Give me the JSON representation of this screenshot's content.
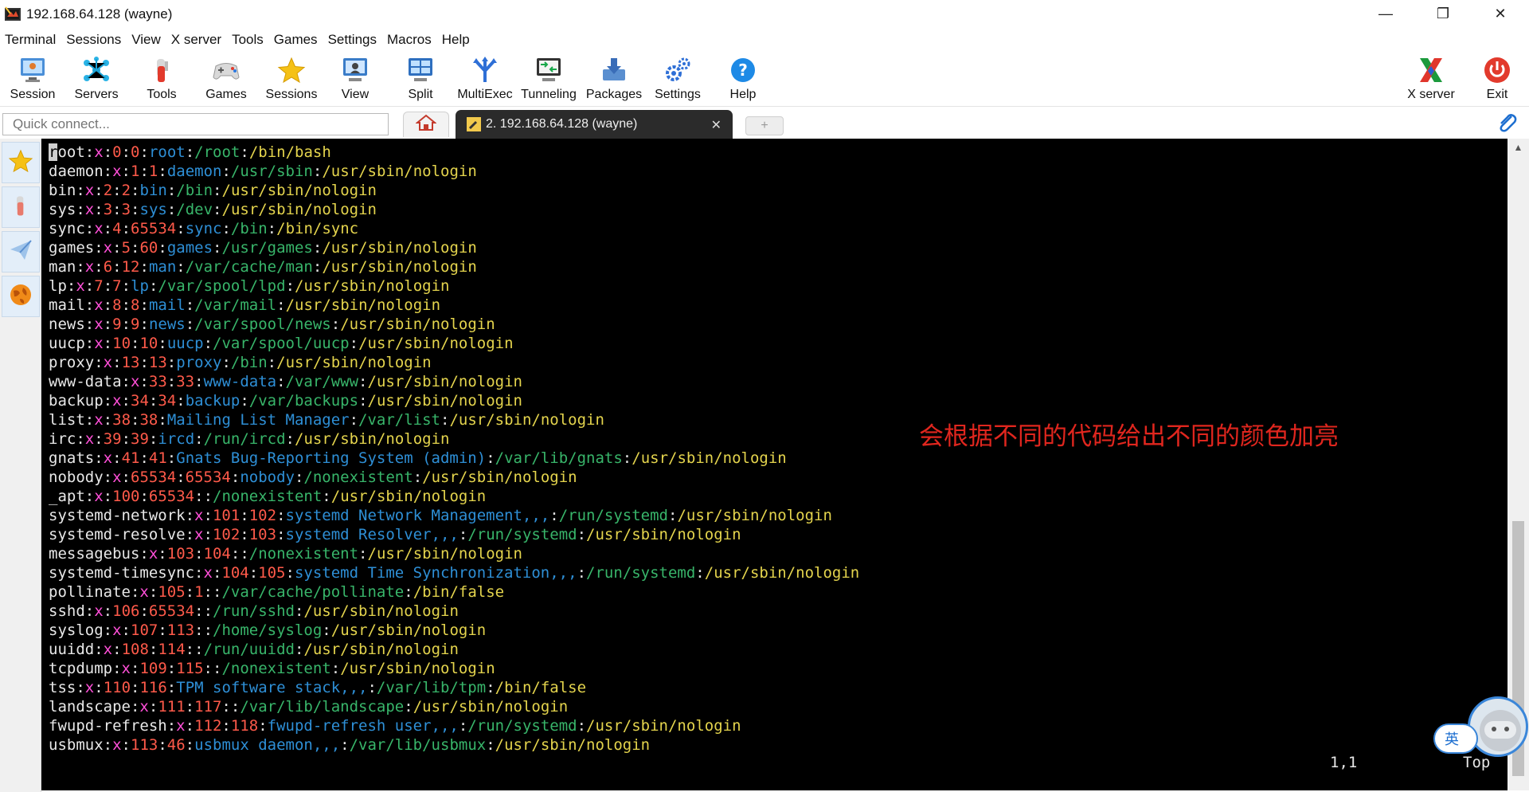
{
  "window": {
    "title": "192.168.64.128 (wayne)",
    "minimize": "—",
    "maximize": "❐",
    "close": "✕"
  },
  "menu": [
    "Terminal",
    "Sessions",
    "View",
    "X server",
    "Tools",
    "Games",
    "Settings",
    "Macros",
    "Help"
  ],
  "toolbar": {
    "session": "Session",
    "servers": "Servers",
    "tools": "Tools",
    "games": "Games",
    "sessions": "Sessions",
    "view": "View",
    "split": "Split",
    "multiexec": "MultiExec",
    "tunneling": "Tunneling",
    "packages": "Packages",
    "settings": "Settings",
    "help": "Help",
    "xserver": "X server",
    "exit": "Exit"
  },
  "quick_connect": {
    "placeholder": "Quick connect..."
  },
  "tab": {
    "label": "2. 192.168.64.128 (wayne)",
    "close": "✕",
    "new_tab": "+"
  },
  "terminal": {
    "lines": [
      [
        "root",
        "x",
        "0",
        "0",
        "root",
        "/root",
        "/bin/bash"
      ],
      [
        "daemon",
        "x",
        "1",
        "1",
        "daemon",
        "/usr/sbin",
        "/usr/sbin/nologin"
      ],
      [
        "bin",
        "x",
        "2",
        "2",
        "bin",
        "/bin",
        "/usr/sbin/nologin"
      ],
      [
        "sys",
        "x",
        "3",
        "3",
        "sys",
        "/dev",
        "/usr/sbin/nologin"
      ],
      [
        "sync",
        "x",
        "4",
        "65534",
        "sync",
        "/bin",
        "/bin/sync"
      ],
      [
        "games",
        "x",
        "5",
        "60",
        "games",
        "/usr/games",
        "/usr/sbin/nologin"
      ],
      [
        "man",
        "x",
        "6",
        "12",
        "man",
        "/var/cache/man",
        "/usr/sbin/nologin"
      ],
      [
        "lp",
        "x",
        "7",
        "7",
        "lp",
        "/var/spool/lpd",
        "/usr/sbin/nologin"
      ],
      [
        "mail",
        "x",
        "8",
        "8",
        "mail",
        "/var/mail",
        "/usr/sbin/nologin"
      ],
      [
        "news",
        "x",
        "9",
        "9",
        "news",
        "/var/spool/news",
        "/usr/sbin/nologin"
      ],
      [
        "uucp",
        "x",
        "10",
        "10",
        "uucp",
        "/var/spool/uucp",
        "/usr/sbin/nologin"
      ],
      [
        "proxy",
        "x",
        "13",
        "13",
        "proxy",
        "/bin",
        "/usr/sbin/nologin"
      ],
      [
        "www-data",
        "x",
        "33",
        "33",
        "www-data",
        "/var/www",
        "/usr/sbin/nologin"
      ],
      [
        "backup",
        "x",
        "34",
        "34",
        "backup",
        "/var/backups",
        "/usr/sbin/nologin"
      ],
      [
        "list",
        "x",
        "38",
        "38",
        "Mailing List Manager",
        "/var/list",
        "/usr/sbin/nologin"
      ],
      [
        "irc",
        "x",
        "39",
        "39",
        "ircd",
        "/run/ircd",
        "/usr/sbin/nologin"
      ],
      [
        "gnats",
        "x",
        "41",
        "41",
        "Gnats Bug-Reporting System (admin)",
        "/var/lib/gnats",
        "/usr/sbin/nologin"
      ],
      [
        "nobody",
        "x",
        "65534",
        "65534",
        "nobody",
        "/nonexistent",
        "/usr/sbin/nologin"
      ],
      [
        "_apt",
        "x",
        "100",
        "65534",
        "",
        "/nonexistent",
        "/usr/sbin/nologin"
      ],
      [
        "systemd-network",
        "x",
        "101",
        "102",
        "systemd Network Management,,,",
        "/run/systemd",
        "/usr/sbin/nologin"
      ],
      [
        "systemd-resolve",
        "x",
        "102",
        "103",
        "systemd Resolver,,,",
        "/run/systemd",
        "/usr/sbin/nologin"
      ],
      [
        "messagebus",
        "x",
        "103",
        "104",
        "",
        "/nonexistent",
        "/usr/sbin/nologin"
      ],
      [
        "systemd-timesync",
        "x",
        "104",
        "105",
        "systemd Time Synchronization,,,",
        "/run/systemd",
        "/usr/sbin/nologin"
      ],
      [
        "pollinate",
        "x",
        "105",
        "1",
        "",
        "/var/cache/pollinate",
        "/bin/false"
      ],
      [
        "sshd",
        "x",
        "106",
        "65534",
        "",
        "/run/sshd",
        "/usr/sbin/nologin"
      ],
      [
        "syslog",
        "x",
        "107",
        "113",
        "",
        "/home/syslog",
        "/usr/sbin/nologin"
      ],
      [
        "uuidd",
        "x",
        "108",
        "114",
        "",
        "/run/uuidd",
        "/usr/sbin/nologin"
      ],
      [
        "tcpdump",
        "x",
        "109",
        "115",
        "",
        "/nonexistent",
        "/usr/sbin/nologin"
      ],
      [
        "tss",
        "x",
        "110",
        "116",
        "TPM software stack,,,",
        "/var/lib/tpm",
        "/bin/false"
      ],
      [
        "landscape",
        "x",
        "111",
        "117",
        "",
        "/var/lib/landscape",
        "/usr/sbin/nologin"
      ],
      [
        "fwupd-refresh",
        "x",
        "112",
        "118",
        "fwupd-refresh user,,,",
        "/run/systemd",
        "/usr/sbin/nologin"
      ],
      [
        "usbmux",
        "x",
        "113",
        "46",
        "usbmux daemon,,,",
        "/var/lib/usbmux",
        "/usr/sbin/nologin"
      ]
    ],
    "annotation": "会根据不同的代码给出不同的颜色加亮",
    "cursor_position": "1,1",
    "scroll_position": "Top"
  },
  "ime": {
    "label": "英"
  },
  "colors": {
    "username": "#e8e8e8",
    "password": "#ff4fd8",
    "ids": "#ff5a4a",
    "gecos": "#2e8fd6",
    "home": "#38b56a",
    "shell": "#e4d44d",
    "annotation": "#e0261e",
    "terminal_bg": "#000000"
  }
}
